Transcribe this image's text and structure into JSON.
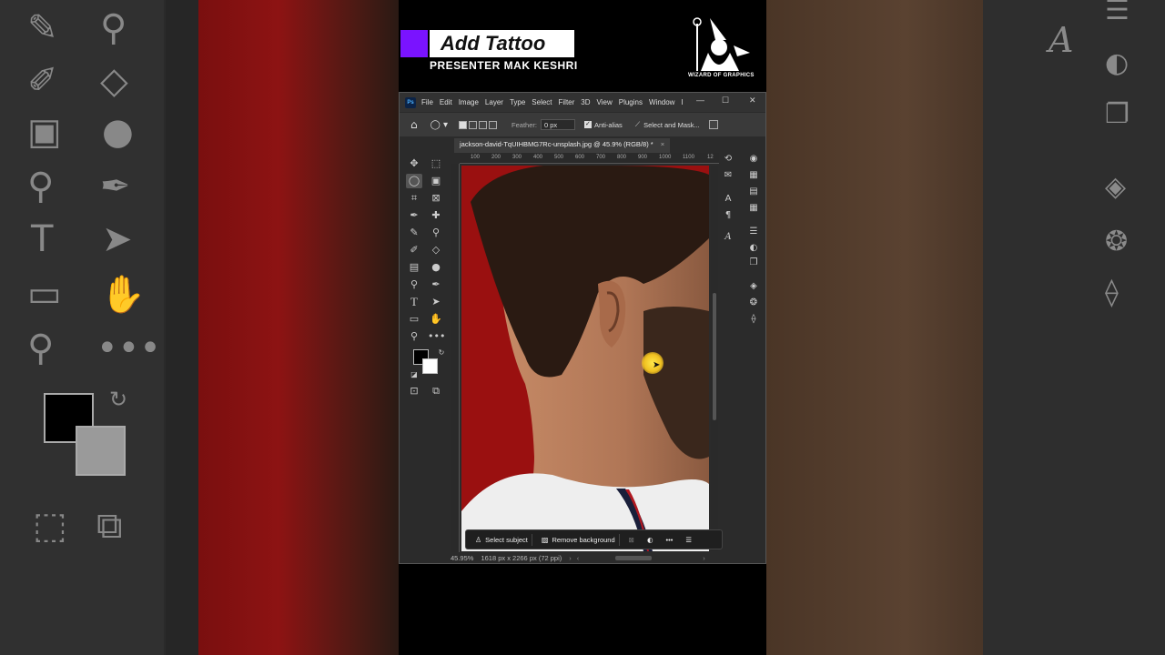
{
  "header": {
    "title": "Add Tattoo",
    "presenter": "PRESENTER MAK KESHRI",
    "logo_text": "WIZARD OF GRAPHICS",
    "accent_color": "#7a13ff"
  },
  "menubar": {
    "items": [
      "File",
      "Edit",
      "Image",
      "Layer",
      "Type",
      "Select",
      "Filter",
      "3D",
      "View",
      "Plugins",
      "Window",
      "I"
    ],
    "ps_logo": "Ps",
    "minimize": "—",
    "maximize": "☐",
    "close": "✕"
  },
  "options": {
    "feather_label": "Feather:",
    "feather_value": "0 px",
    "antialias_label": "Anti-alias",
    "select_mask_label": "Select and Mask..."
  },
  "document": {
    "tab_title": "jackson-david-TqUIHBMG7Rc-unsplash.jpg @ 45.9% (RGB/8) *",
    "close_tab": "×"
  },
  "ruler": {
    "ticks": [
      "100",
      "200",
      "300",
      "400",
      "500",
      "600",
      "700",
      "800",
      "900",
      "1000",
      "1100",
      "12"
    ]
  },
  "context_bar": {
    "select_subject": "Select subject",
    "remove_background": "Remove background"
  },
  "status": {
    "zoom": "45.95%",
    "dimensions": "1618 px x 2266 px (72 ppi)"
  },
  "icons": {
    "home": "home-icon",
    "lasso": "lasso-icon",
    "move": "move-icon",
    "marquee": "marquee-icon",
    "crop": "crop-icon",
    "eyedropper": "eyedropper-icon",
    "brush": "brush-icon",
    "stamp": "clone-stamp-icon",
    "eraser": "eraser-icon",
    "gradient": "gradient-icon",
    "dodge": "dodge-icon",
    "pen": "pen-icon",
    "type": "type-icon",
    "path": "path-select-icon",
    "rect": "rectangle-icon",
    "hand": "hand-icon",
    "zoom": "zoom-icon",
    "more": "more-icon"
  }
}
